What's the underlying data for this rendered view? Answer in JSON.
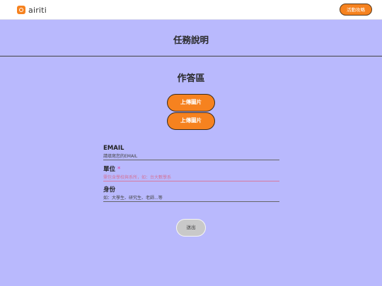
{
  "header": {
    "logo_text": "airiti",
    "action_button_label": "活動攻略"
  },
  "task": {
    "title": "任務說明"
  },
  "answer": {
    "title": "作答區",
    "upload_buttons": [
      {
        "label": "上傳圖片"
      },
      {
        "label": "上傳圖片"
      }
    ]
  },
  "form": {
    "email": {
      "label": "EMAIL",
      "placeholder": "請填寫您的EMAIL",
      "value": ""
    },
    "unit": {
      "label": "單位",
      "required_mark": "*",
      "placeholder": "需包含學校與系所，如：台大數學系",
      "value": ""
    },
    "identity": {
      "label": "身份",
      "placeholder": "如：大學生、研究生、老師...等",
      "value": ""
    },
    "submit_label": "送出"
  },
  "colors": {
    "background": "#b9b9fd",
    "accent": "#f6821f",
    "error": "#d4739a"
  }
}
